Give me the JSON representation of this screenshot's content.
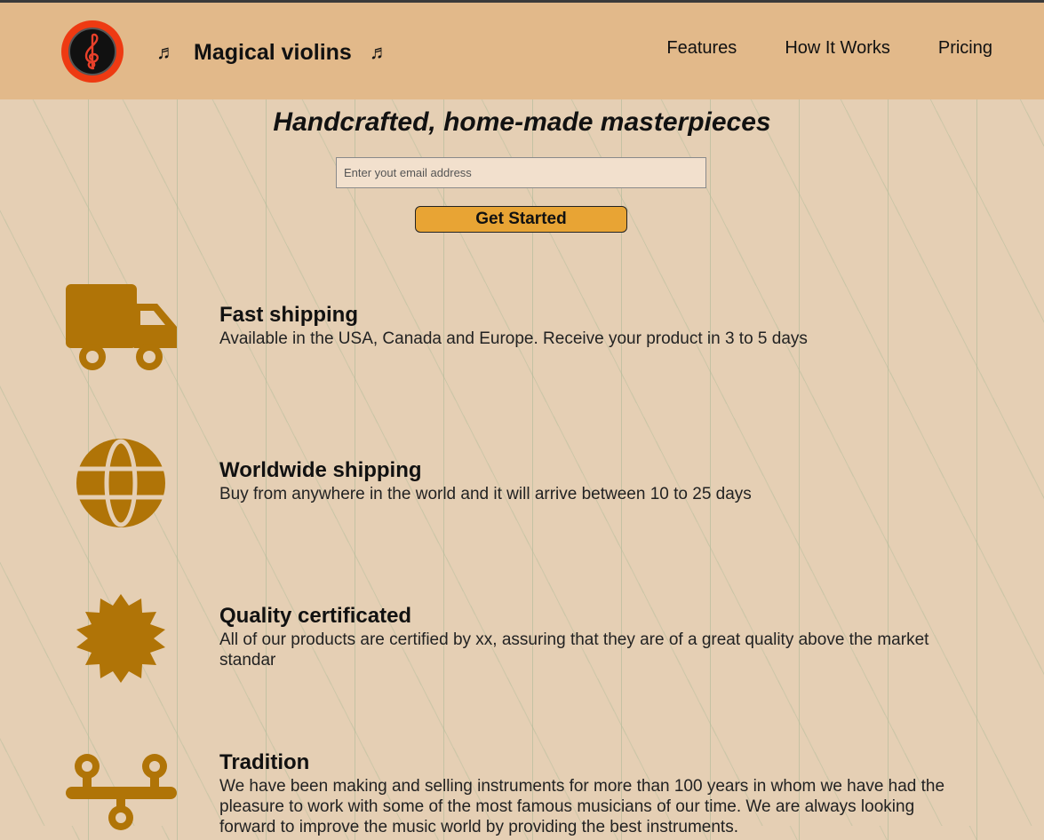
{
  "header": {
    "brand_name": "Magical violins",
    "brand_note_left": "♬",
    "brand_note_right": "♬",
    "nav": [
      "Features",
      "How It Works",
      "Pricing"
    ]
  },
  "hero": {
    "title": "Handcrafted, home-made masterpieces",
    "email_placeholder": "Enter yout email address",
    "button_label": "Get Started"
  },
  "features": [
    {
      "icon": "truck-icon",
      "title": "Fast shipping",
      "text": "Available in the USA, Canada and Europe. Receive your product in 3 to 5 days"
    },
    {
      "icon": "globe-icon",
      "title": "Worldwide shipping",
      "text": "Buy from anywhere in the world and it will arrive between 10 to 25 days"
    },
    {
      "icon": "certificate-icon",
      "title": "Quality certificated",
      "text": "All of our products are certified by xx, assuring that they are of a great quality above the market standar"
    },
    {
      "icon": "tradition-icon",
      "title": "Tradition",
      "text": "We have been making and selling instruments for more than 100 years in whom we have had the pleasure to work with some of the most famous musicians of our time. We are always looking forward to improve the music world by providing the best instruments."
    }
  ],
  "colors": {
    "header_bg": "#e2b98a",
    "page_bg": "#e5cfb4",
    "icon": "#b07407",
    "button": "#e8a434",
    "logo_ring": "#ee3a12"
  }
}
